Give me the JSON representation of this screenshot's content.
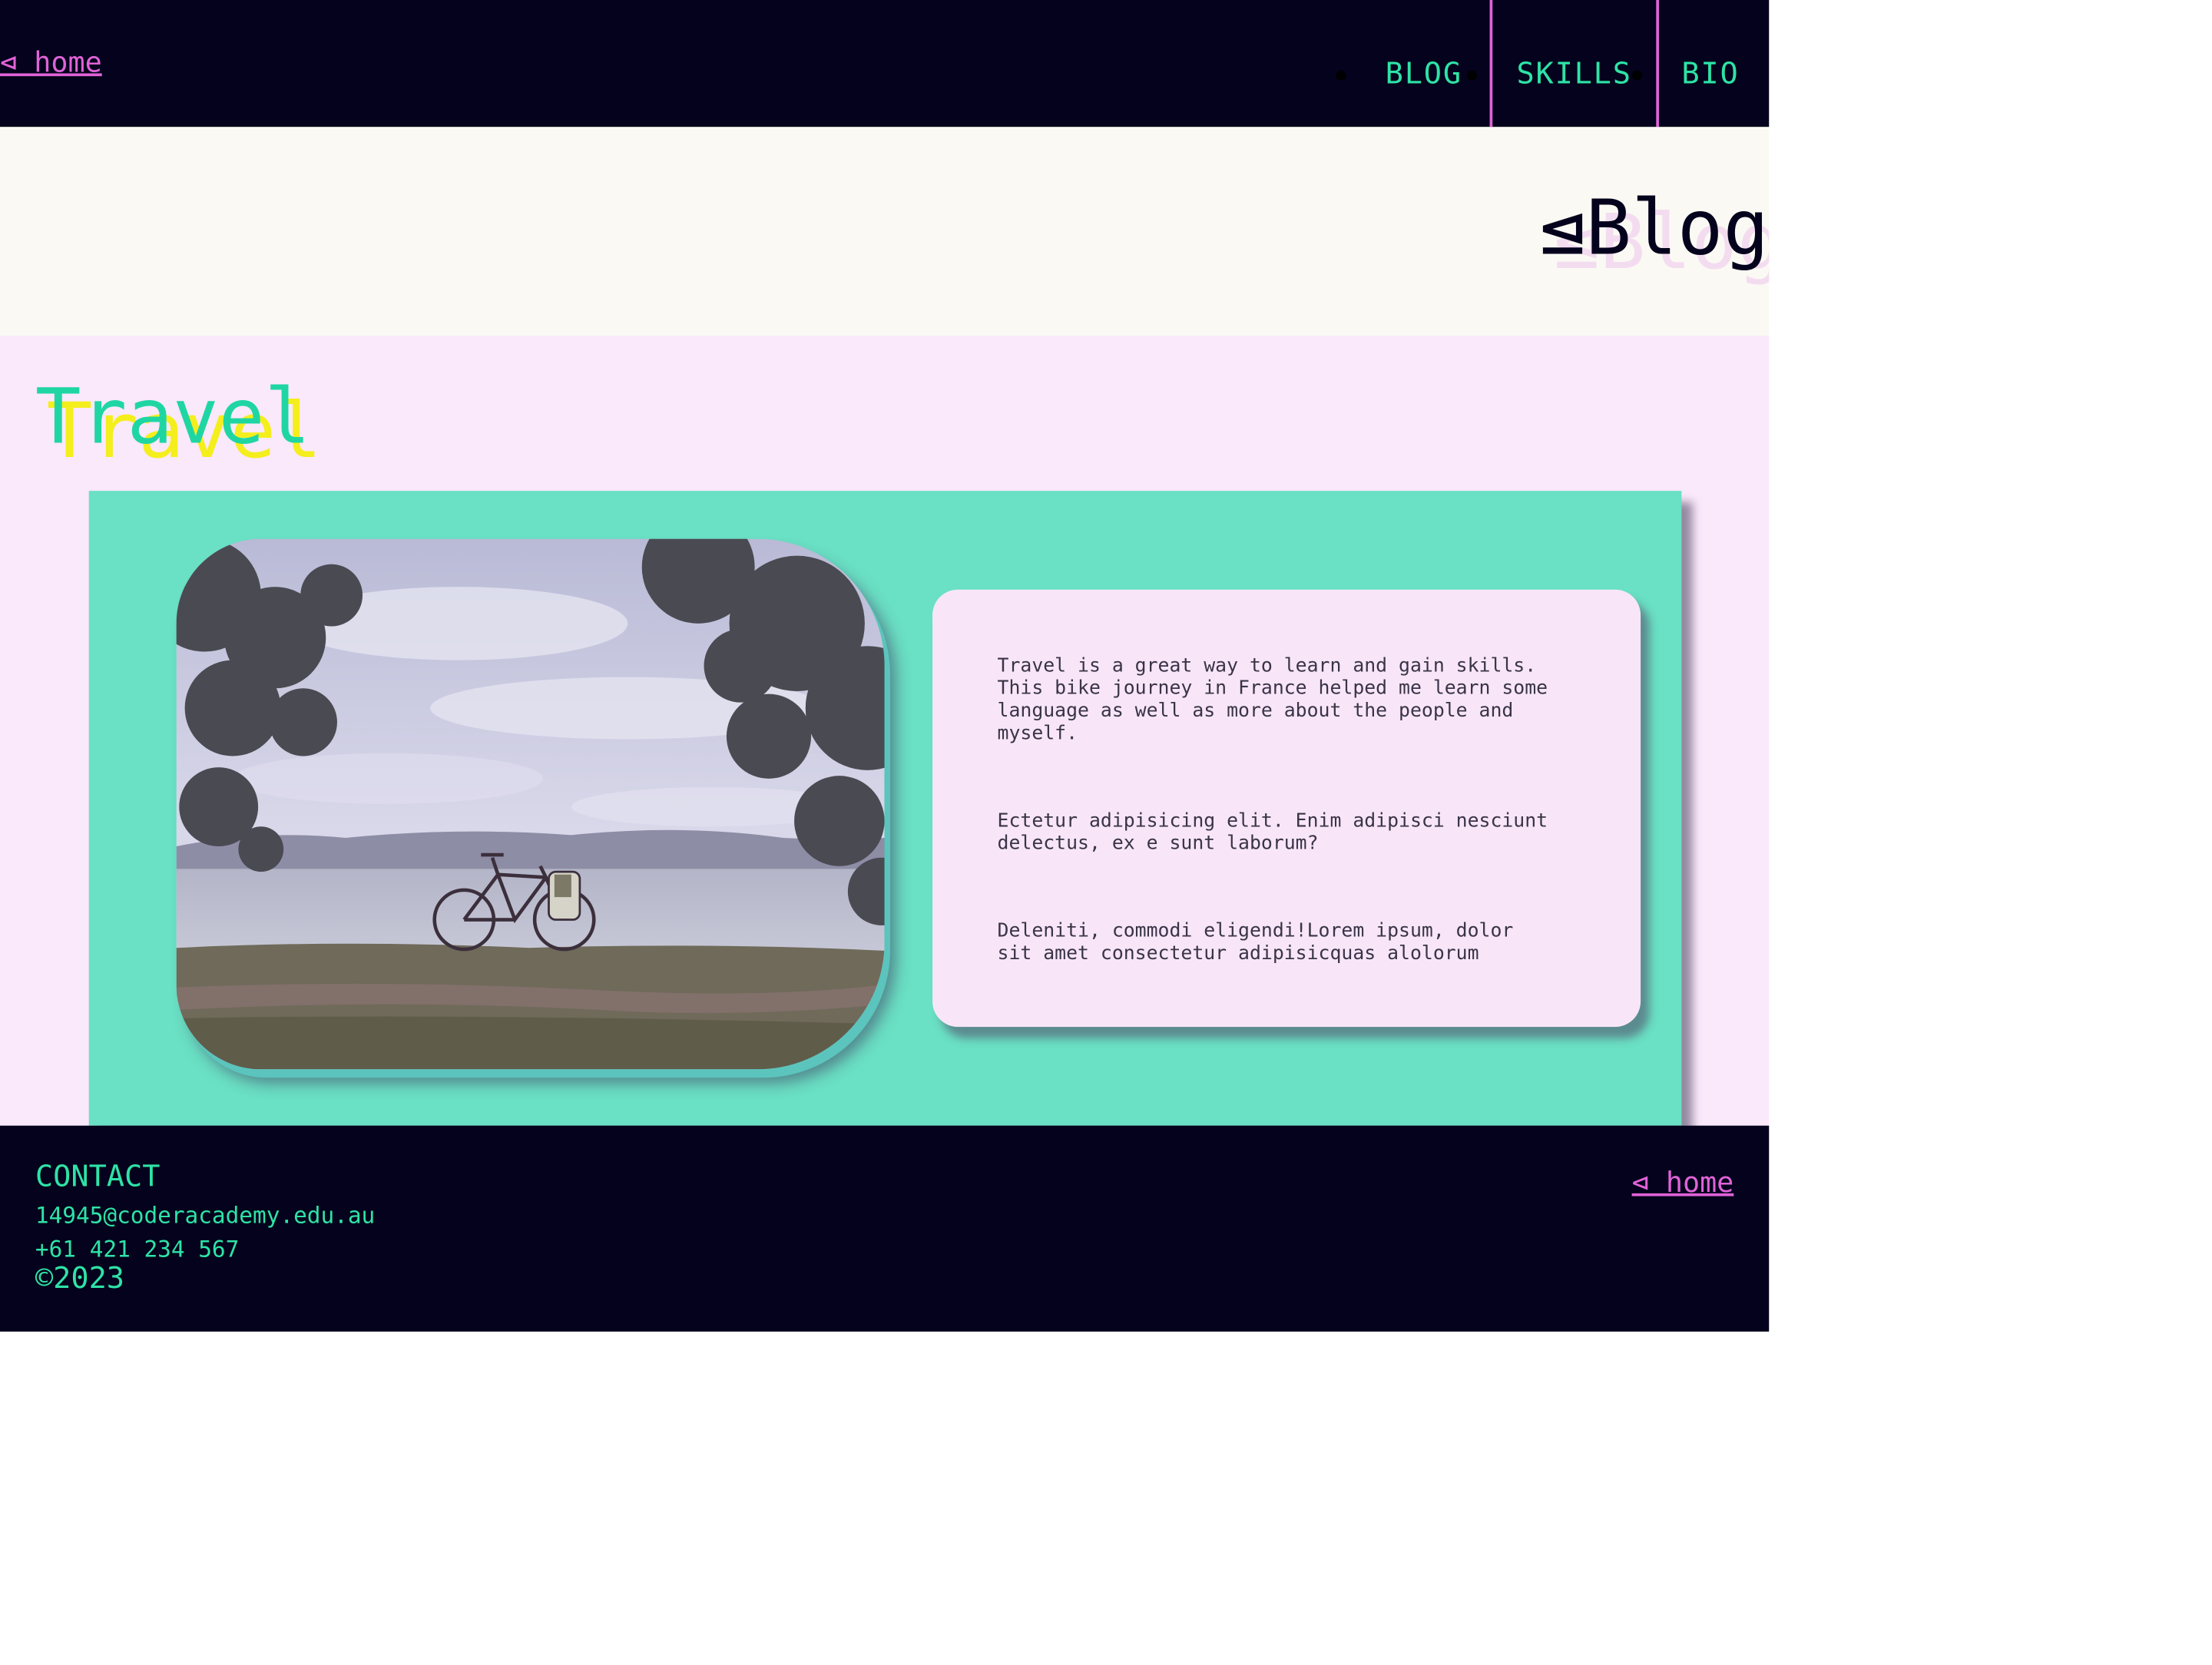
{
  "header": {
    "home_link": "⊲ home",
    "nav": [
      "BLOG",
      "SKILLS",
      "BIO"
    ]
  },
  "banner": {
    "title": "⊴Blog"
  },
  "section": {
    "title": "Travel",
    "photo_alt": "bicycle",
    "paragraphs": [
      "Travel is a great way to learn and gain skills.\nThis bike journey in France helped me learn some\nlanguage as well as more about the people and\nmyself.",
      "Ectetur adipisicing elit. Enim adipisci nesciunt\ndelectus, ex e sunt laborum?",
      "Deleniti, commodi eligendi!Lorem ipsum, dolor\nsit amet consectetur adipisicquas alolorum"
    ]
  },
  "footer": {
    "contact_heading": "CONTACT",
    "email": "14945@coderacademy.edu.au",
    "phone": "+61 421 234 567",
    "copyright": "©2023",
    "home_link": "⊲ home"
  },
  "colors": {
    "navy": "#04021c",
    "accent_pink": "#e063d8",
    "accent_green": "#2ee3a6",
    "card_teal": "#6ae0c4",
    "section_bg": "#fae8fb",
    "banner_bg": "#fbf9f3",
    "title_shadow_yellow": "#f4ee1c"
  }
}
